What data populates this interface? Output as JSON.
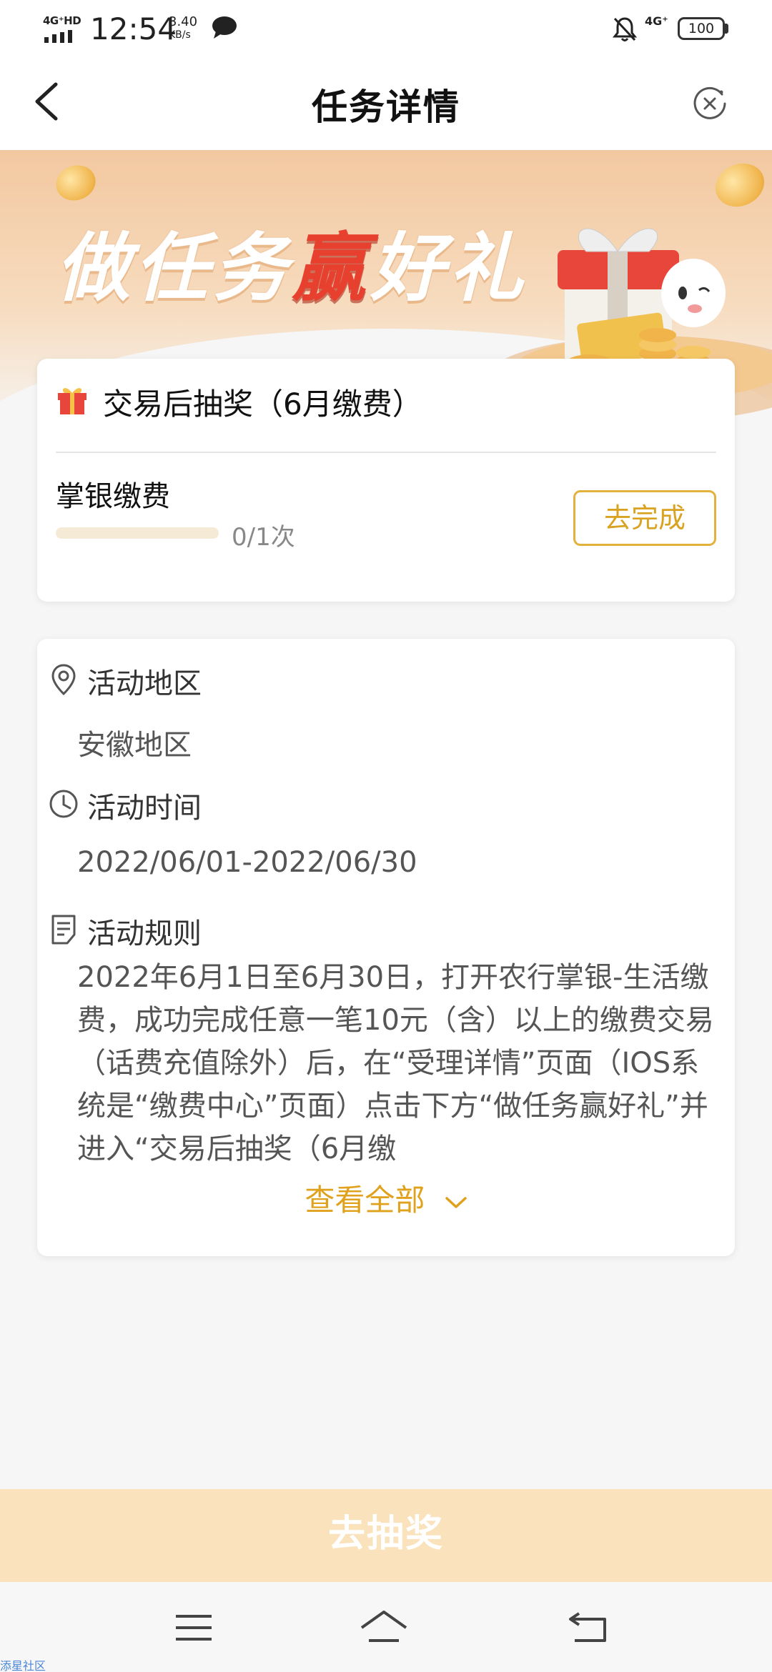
{
  "status_bar": {
    "network_left": "4G⁺HD",
    "time": "12:54",
    "speed_value": "3.40",
    "speed_unit": "KB/s",
    "network_right": "4G⁺",
    "battery": "100",
    "icons": [
      "signal-icon",
      "chat-icon",
      "mute-bell-icon",
      "battery-icon"
    ]
  },
  "header": {
    "title": "任务详情",
    "back_icon": "chevron-left-icon",
    "close_icon": "close-circle-icon"
  },
  "banner": {
    "prefix": "做任务",
    "highlight": "赢",
    "suffix": "好礼",
    "highlight_color": "#e8402f"
  },
  "task": {
    "title": "交易后抽奖（6月缴费）",
    "name": "掌银缴费",
    "progress_done": 0,
    "progress_total": 1,
    "count_text": "0/1次",
    "action_label": "去完成",
    "accent": "#e3b23c"
  },
  "info": {
    "region_label": "活动地区",
    "region_value": "安徽地区",
    "time_label": "活动时间",
    "time_value": "2022/06/01-2022/06/30",
    "rules_label": "活动规则",
    "rules_text": "2022年6月1日至6月30日，打开农行掌银-生活缴费，成功完成任意一笔10元（含）以上的缴费交易（话费充值除外）后，在“受理详情”页面（IOS系统是“缴费中心”页面）点击下方“做任务赢好礼”并进入“交易后抽奖（6月缴",
    "view_all": "查看全部"
  },
  "draw_button": "去抽奖",
  "nav_bar": {
    "icons": [
      "menu-icon",
      "home-icon",
      "back-icon"
    ]
  },
  "watermark": "添星社区"
}
